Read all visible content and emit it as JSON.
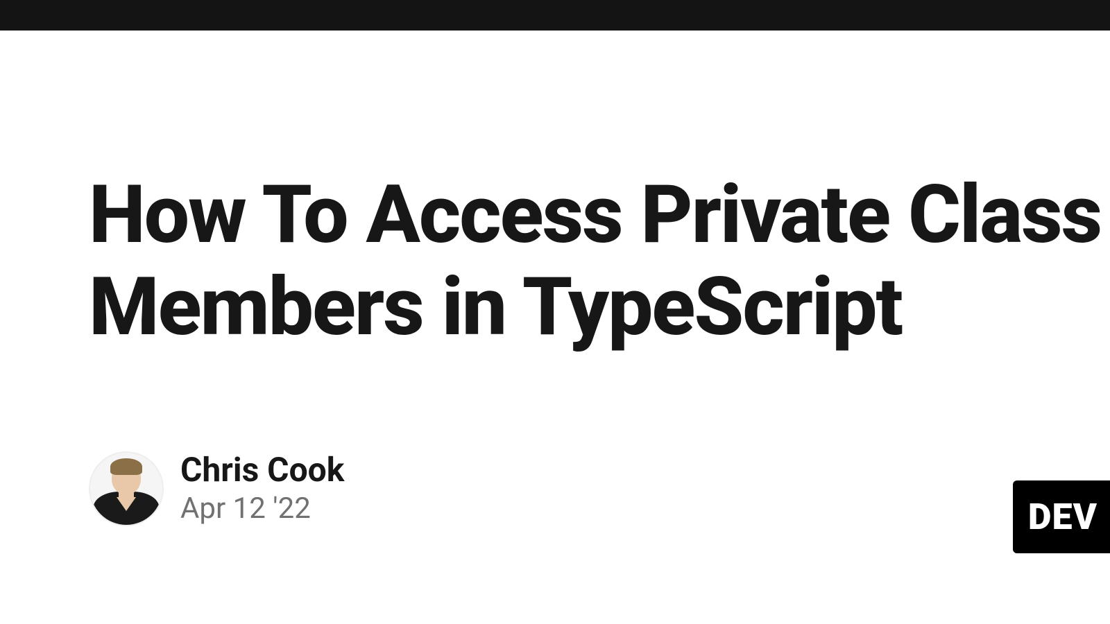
{
  "article": {
    "title": "How To Access Private Class Members in TypeScript"
  },
  "author": {
    "name": "Chris Cook",
    "date": "Apr 12 '22"
  },
  "badge": {
    "text": "DEV"
  }
}
